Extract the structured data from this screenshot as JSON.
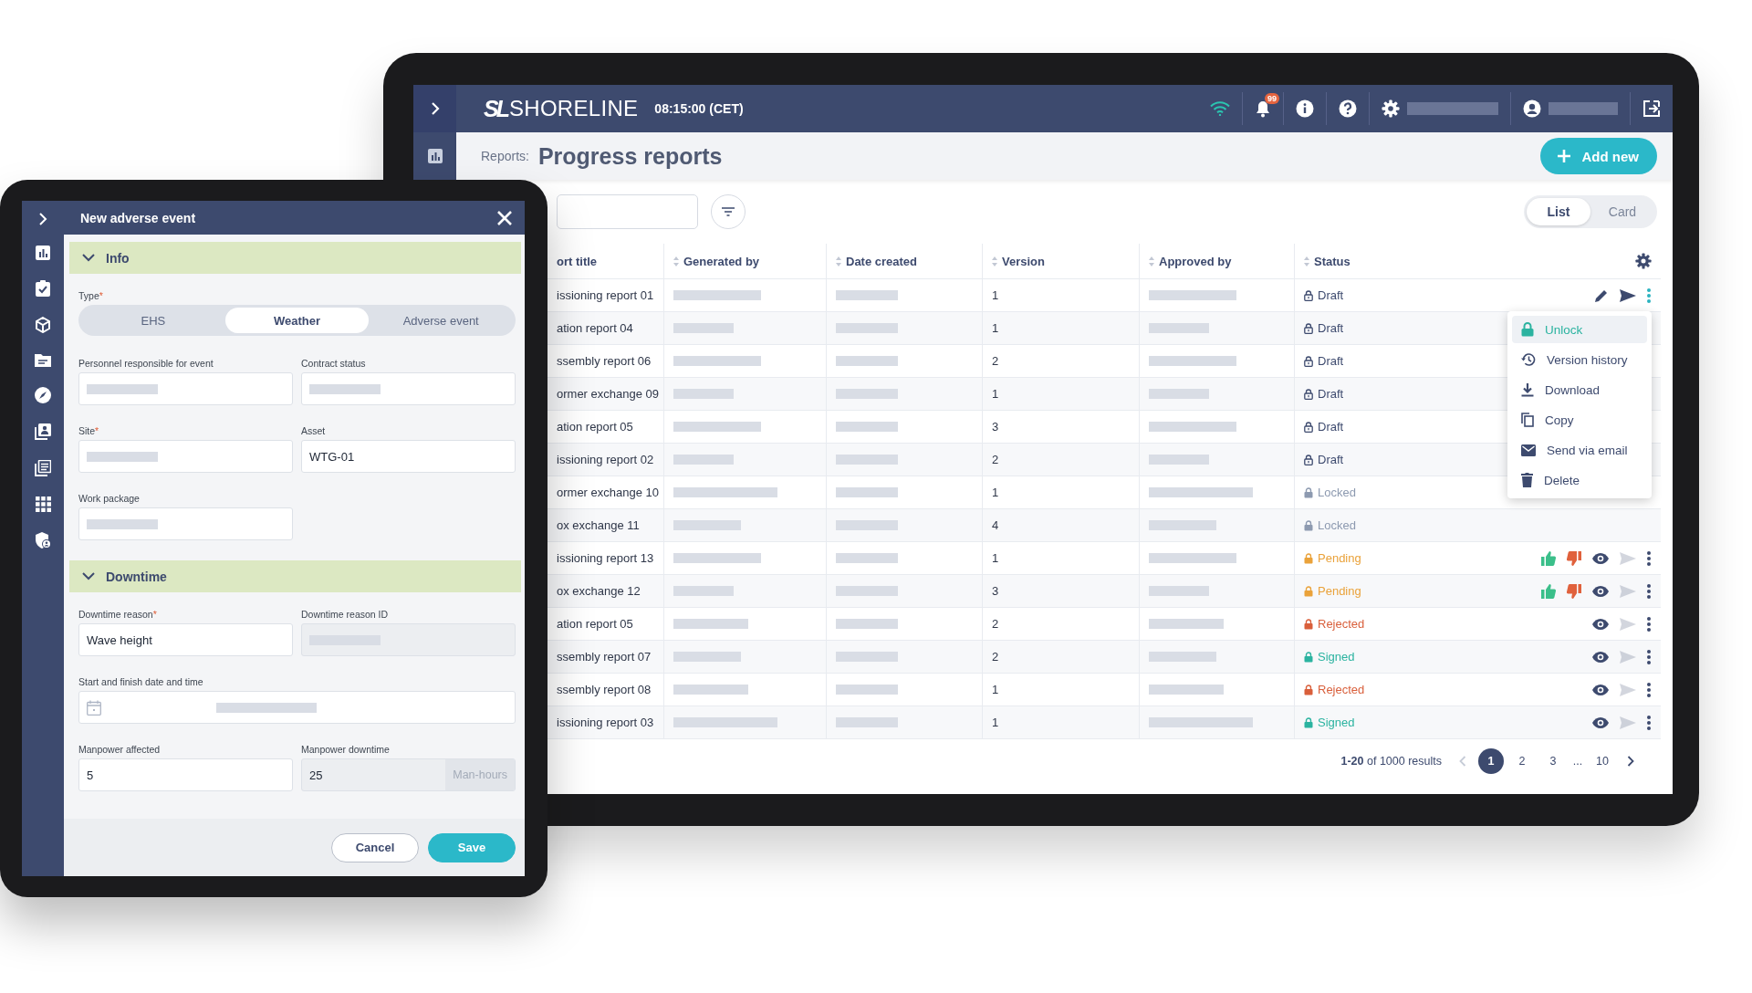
{
  "monitor": {
    "header": {
      "logo_mark": "SL",
      "logo_text": "SHORELINE",
      "time": "08:15:00 (CET)",
      "notification_count": "99"
    },
    "page": {
      "breadcrumb": "Reports:",
      "title": "Progress reports",
      "add_button": "Add new"
    },
    "view_toggle": [
      {
        "label": "List",
        "selected": true
      },
      {
        "label": "Card",
        "selected": false
      }
    ],
    "table": {
      "columns": [
        {
          "label": "ort title",
          "sortable": false
        },
        {
          "label": "Generated by",
          "sortable": true
        },
        {
          "label": "Date created",
          "sortable": true
        },
        {
          "label": "Version",
          "sortable": true
        },
        {
          "label": "Approved by",
          "sortable": true
        },
        {
          "label": "Status",
          "sortable": true
        }
      ],
      "rows": [
        {
          "title": "issioning report 01",
          "version": "1",
          "status": {
            "kind": "draft",
            "label": "Draft"
          },
          "actions": [
            {
              "kind": "edit"
            },
            {
              "kind": "send",
              "disabled": false
            },
            {
              "kind": "more"
            }
          ],
          "menu": [
            {
              "kind": "unlock",
              "label": "Unlock",
              "selected": true
            },
            {
              "kind": "history",
              "label": "Version history",
              "selected": false
            },
            {
              "kind": "download",
              "label": "Download",
              "selected": false
            },
            {
              "kind": "copy",
              "label": "Copy",
              "selected": false
            },
            {
              "kind": "email",
              "label": "Send via email",
              "selected": false
            },
            {
              "kind": "delete",
              "label": "Delete",
              "selected": false
            }
          ]
        },
        {
          "title": "ation report 04",
          "version": "1",
          "status": {
            "kind": "draft",
            "label": "Draft"
          },
          "actions": []
        },
        {
          "title": "ssembly report 06",
          "version": "2",
          "status": {
            "kind": "draft",
            "label": "Draft"
          },
          "actions": []
        },
        {
          "title": "ormer exchange 09",
          "version": "1",
          "status": {
            "kind": "draft",
            "label": "Draft"
          },
          "actions": []
        },
        {
          "title": "ation report 05",
          "version": "3",
          "status": {
            "kind": "draft",
            "label": "Draft"
          },
          "actions": []
        },
        {
          "title": "issioning report 02",
          "version": "2",
          "status": {
            "kind": "draft",
            "label": "Draft"
          },
          "actions": []
        },
        {
          "title": "ormer exchange 10",
          "version": "1",
          "status": {
            "kind": "locked",
            "label": "Locked"
          },
          "actions": []
        },
        {
          "title": "ox exchange 11",
          "version": "4",
          "status": {
            "kind": "locked",
            "label": "Locked"
          },
          "actions": []
        },
        {
          "title": "issioning report 13",
          "version": "1",
          "status": {
            "kind": "pending",
            "label": "Pending"
          },
          "actions": [
            {
              "kind": "approve"
            },
            {
              "kind": "reject"
            },
            {
              "kind": "view"
            },
            {
              "kind": "send",
              "disabled": true
            },
            {
              "kind": "more"
            }
          ]
        },
        {
          "title": "ox exchange 12",
          "version": "3",
          "status": {
            "kind": "pending",
            "label": "Pending"
          },
          "actions": [
            {
              "kind": "approve"
            },
            {
              "kind": "reject"
            },
            {
              "kind": "view"
            },
            {
              "kind": "send",
              "disabled": true
            },
            {
              "kind": "more"
            }
          ]
        },
        {
          "title": "ation report 05",
          "version": "2",
          "status": {
            "kind": "rejected",
            "label": "Rejected"
          },
          "actions": [
            {
              "kind": "view"
            },
            {
              "kind": "send",
              "disabled": true
            },
            {
              "kind": "more"
            }
          ]
        },
        {
          "title": "ssembly report 07",
          "version": "2",
          "status": {
            "kind": "signed",
            "label": "Signed"
          },
          "actions": [
            {
              "kind": "view"
            },
            {
              "kind": "send",
              "disabled": true
            },
            {
              "kind": "more"
            }
          ]
        },
        {
          "title": "ssembly report 08",
          "version": "1",
          "status": {
            "kind": "rejected",
            "label": "Rejected"
          },
          "actions": [
            {
              "kind": "view"
            },
            {
              "kind": "send",
              "disabled": true
            },
            {
              "kind": "more"
            }
          ]
        },
        {
          "title": "issioning report 03",
          "version": "1",
          "status": {
            "kind": "signed",
            "label": "Signed"
          },
          "actions": [
            {
              "kind": "view"
            },
            {
              "kind": "send",
              "disabled": true
            },
            {
              "kind": "more"
            }
          ]
        }
      ]
    },
    "pagination": {
      "summary": "**1-20** of 1000 results",
      "prev_disabled": true,
      "next_disabled": false,
      "pages": [
        {
          "label": "1",
          "kind": "page",
          "selected": true
        },
        {
          "label": "2",
          "kind": "page",
          "selected": false
        },
        {
          "label": "3",
          "kind": "page",
          "selected": false
        },
        {
          "label": "...",
          "kind": "ellipsis"
        },
        {
          "label": "10",
          "kind": "page",
          "selected": false
        }
      ]
    }
  },
  "tablet": {
    "title": "New adverse event",
    "sections": [
      {
        "title": "Info",
        "expanded": true,
        "type_field": {
          "label": "Type",
          "required_mark": "*",
          "options": [
            {
              "label": "EHS",
              "selected": false
            },
            {
              "label": "Weather",
              "selected": true
            },
            {
              "label": "Adverse event",
              "selected": false
            }
          ]
        },
        "fields": [
          {
            "kind": "text",
            "label": "Personnel responsible for event",
            "redacted": true,
            "disabled": false
          },
          {
            "kind": "text",
            "label": "Contract status",
            "redacted": true,
            "disabled": false
          },
          {
            "kind": "text",
            "label": "Site",
            "required_mark": "*",
            "redacted": true,
            "disabled": false
          },
          {
            "kind": "text",
            "label": "Asset",
            "value": "WTG-01",
            "redacted": false,
            "disabled": false
          },
          {
            "kind": "text",
            "label": "Work package",
            "redacted": true,
            "disabled": false
          }
        ]
      },
      {
        "title": "Downtime",
        "expanded": true,
        "fields": [
          {
            "kind": "text",
            "label": "Downtime reason",
            "required_mark": "*",
            "value": "Wave height",
            "redacted": false,
            "disabled": false
          },
          {
            "kind": "text",
            "label": "Downtime reason ID",
            "redacted": true,
            "disabled": true
          },
          {
            "kind": "date",
            "label": "Start and finish date and time",
            "redacted": true,
            "disabled": false
          },
          {
            "kind": "text",
            "label": "Manpower affected",
            "value": "5",
            "redacted": false,
            "disabled": false
          },
          {
            "kind": "unit",
            "label": "Manpower downtime",
            "value": "25",
            "suffix": "Man-hours",
            "redacted": false,
            "disabled": true
          }
        ]
      }
    ],
    "buttons": [
      {
        "kind": "secondary",
        "label": "Cancel"
      },
      {
        "kind": "primary",
        "label": "Save"
      }
    ]
  }
}
